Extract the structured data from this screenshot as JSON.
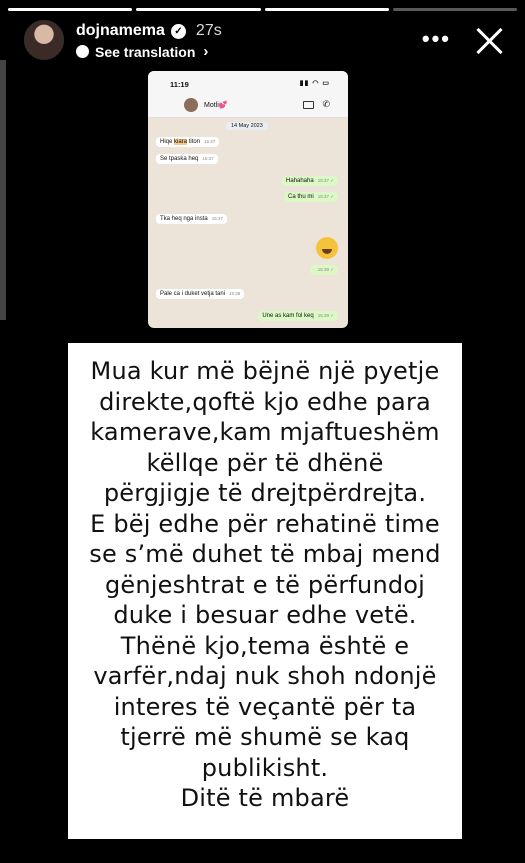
{
  "story": {
    "username": "dojnamema",
    "time_ago": "27s",
    "translation_label": "See translation",
    "more_label": "•••"
  },
  "chat_screenshot": {
    "status_time": "11:19",
    "contact_name": "Motli💕",
    "date_label": "14 May 2023",
    "messages": [
      {
        "dir": "in",
        "pre": "Hiqe ",
        "hl": "kiara",
        "post": " titon",
        "time": "15:37"
      },
      {
        "dir": "in",
        "text": "Se tpaska heq",
        "time": "15:37"
      },
      {
        "dir": "out",
        "text": "Hahahaha",
        "time": "15:37 ✓"
      },
      {
        "dir": "out",
        "text": "Ca thu mi",
        "time": "15:37 ✓"
      },
      {
        "dir": "in",
        "text": "Tka heq nga insta",
        "time": "15:37"
      },
      {
        "dir": "out",
        "text": "",
        "time": "15:38 ✓"
      },
      {
        "dir": "in",
        "text": "Pale ca i duket vetja tani",
        "time": "15:38"
      },
      {
        "dir": "out",
        "text": "Une as kam fol keq",
        "time": "15:38 ✓"
      }
    ]
  },
  "text_card": {
    "lines": [
      "Mua kur më bëjnë një pyetje",
      "direkte,qoftë kjo edhe para",
      "kamerave,kam mjaftueshëm",
      "këllqe për të dhënë",
      "përgjigje të drejtpërdrejta.",
      "E bëj edhe për rehatinë time",
      "se s’më duhet të mbaj mend",
      "gënjeshtrat e të përfundoj",
      "duke i besuar edhe vetë.",
      "Thënë kjo,tema është e",
      "varfër,ndaj nuk shoh ndonjë",
      "interes të veçantë për ta",
      "tjerrë më shumë se kaq",
      "publikisht.",
      "Ditë të mbarë"
    ]
  }
}
